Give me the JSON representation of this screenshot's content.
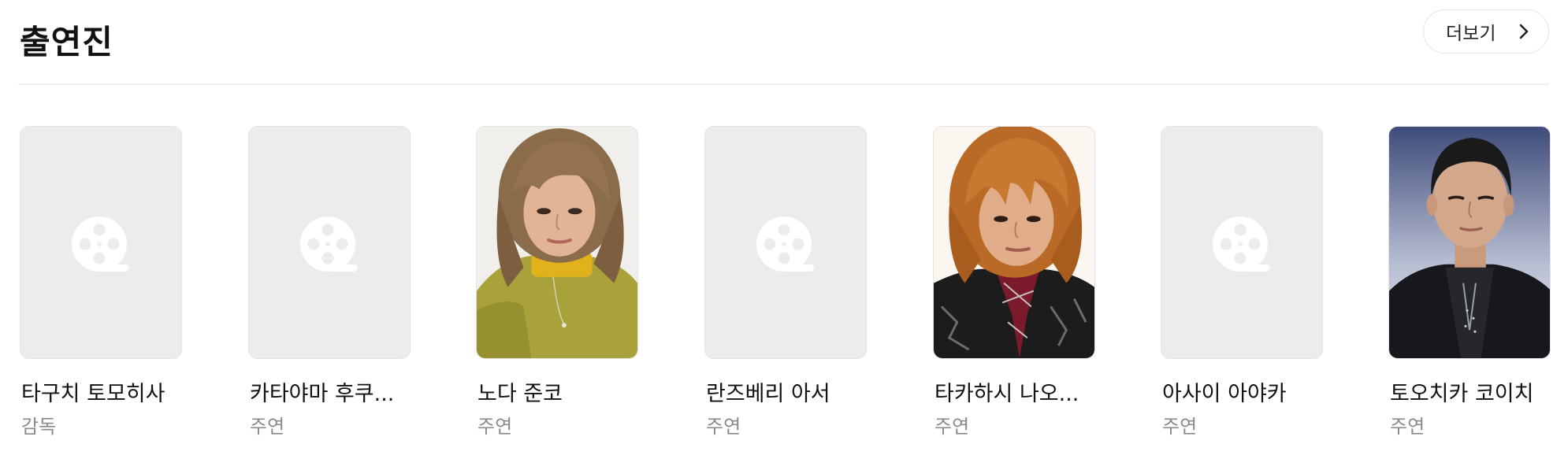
{
  "section": {
    "title": "출연진",
    "more_label": "더보기"
  },
  "cast": [
    {
      "name": "타구치 토모히사",
      "role": "감독",
      "photo": "placeholder-film-reel"
    },
    {
      "name": "카타야마 후쿠...",
      "role": "주연",
      "photo": "placeholder-film-reel"
    },
    {
      "name": "노다 준코",
      "role": "주연",
      "photo": "portrait-woman-yellow-sweater"
    },
    {
      "name": "란즈베리 아서",
      "role": "주연",
      "photo": "placeholder-film-reel"
    },
    {
      "name": "타카하시 나오...",
      "role": "주연",
      "photo": "portrait-young-man-orange-hair"
    },
    {
      "name": "아사이 아야카",
      "role": "주연",
      "photo": "placeholder-film-reel"
    },
    {
      "name": "토오치카 코이치",
      "role": "주연",
      "photo": "portrait-man-black-jacket"
    }
  ]
}
